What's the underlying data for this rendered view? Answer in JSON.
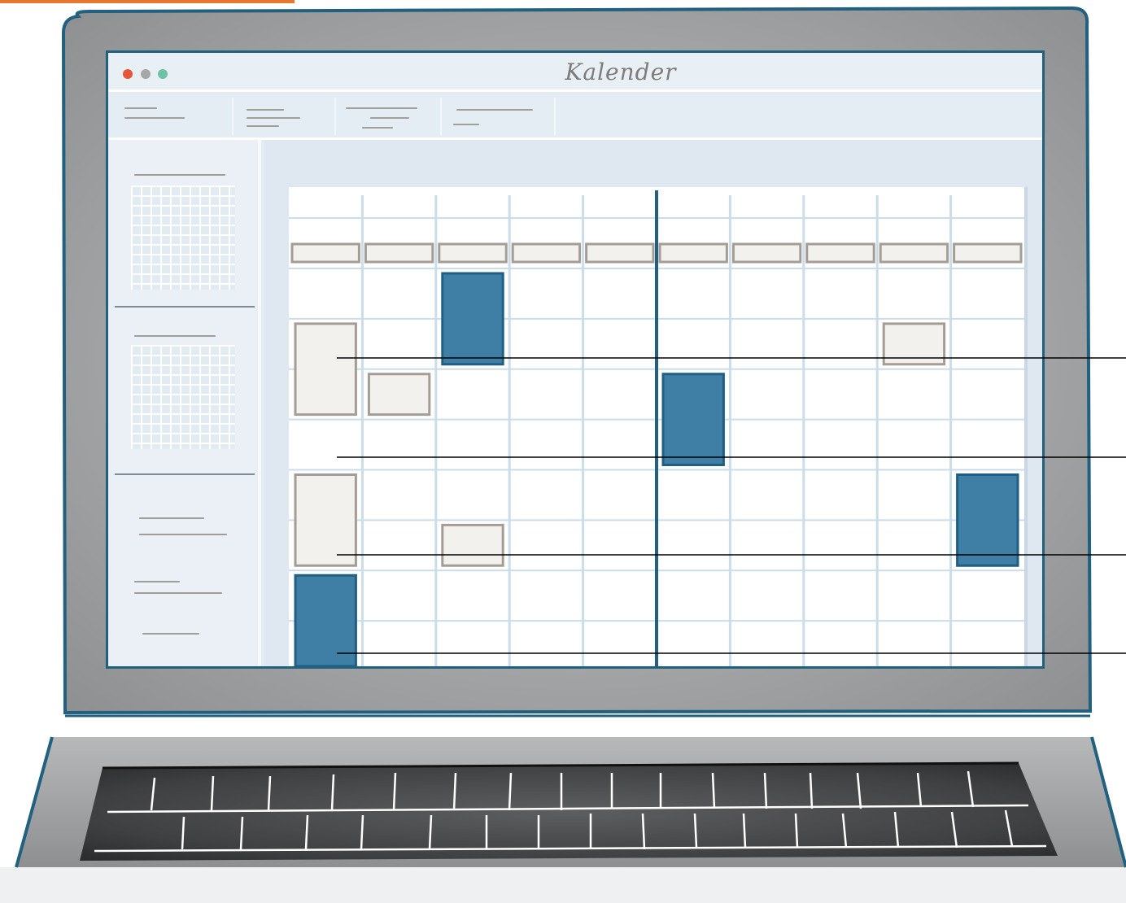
{
  "window": {
    "title": "Kalender",
    "controls": [
      "close-icon",
      "minimize-icon",
      "maximize-icon"
    ]
  },
  "colors": {
    "frame": "#21607f",
    "bezel": "#9a9c9e",
    "event_blue": "#3f7fa6",
    "event_gray": "#f3f1ee",
    "gridline": "#cbdde9",
    "close": "#e85438",
    "minimize": "#a7a8a5",
    "maximize": "#6cc3a8"
  },
  "calendar": {
    "columns": 10,
    "rows": 8,
    "events": [
      {
        "kind": "blue",
        "col": 2,
        "row_start": 0,
        "row_span": 2
      },
      {
        "kind": "gray",
        "col": 0,
        "row_start": 1,
        "row_span": 2
      },
      {
        "kind": "gray",
        "col": 1,
        "row_start": 2,
        "row_span": 1
      },
      {
        "kind": "gray",
        "col": 8,
        "row_start": 1,
        "row_span": 1
      },
      {
        "kind": "blue",
        "col": 5,
        "row_start": 2,
        "row_span": 2
      },
      {
        "kind": "gray",
        "col": 0,
        "row_start": 4,
        "row_span": 2
      },
      {
        "kind": "gray",
        "col": 2,
        "row_start": 5,
        "row_span": 1
      },
      {
        "kind": "blue",
        "col": 9,
        "row_start": 4,
        "row_span": 2
      },
      {
        "kind": "blue",
        "col": 0,
        "row_start": 6,
        "row_span": 2
      }
    ]
  }
}
